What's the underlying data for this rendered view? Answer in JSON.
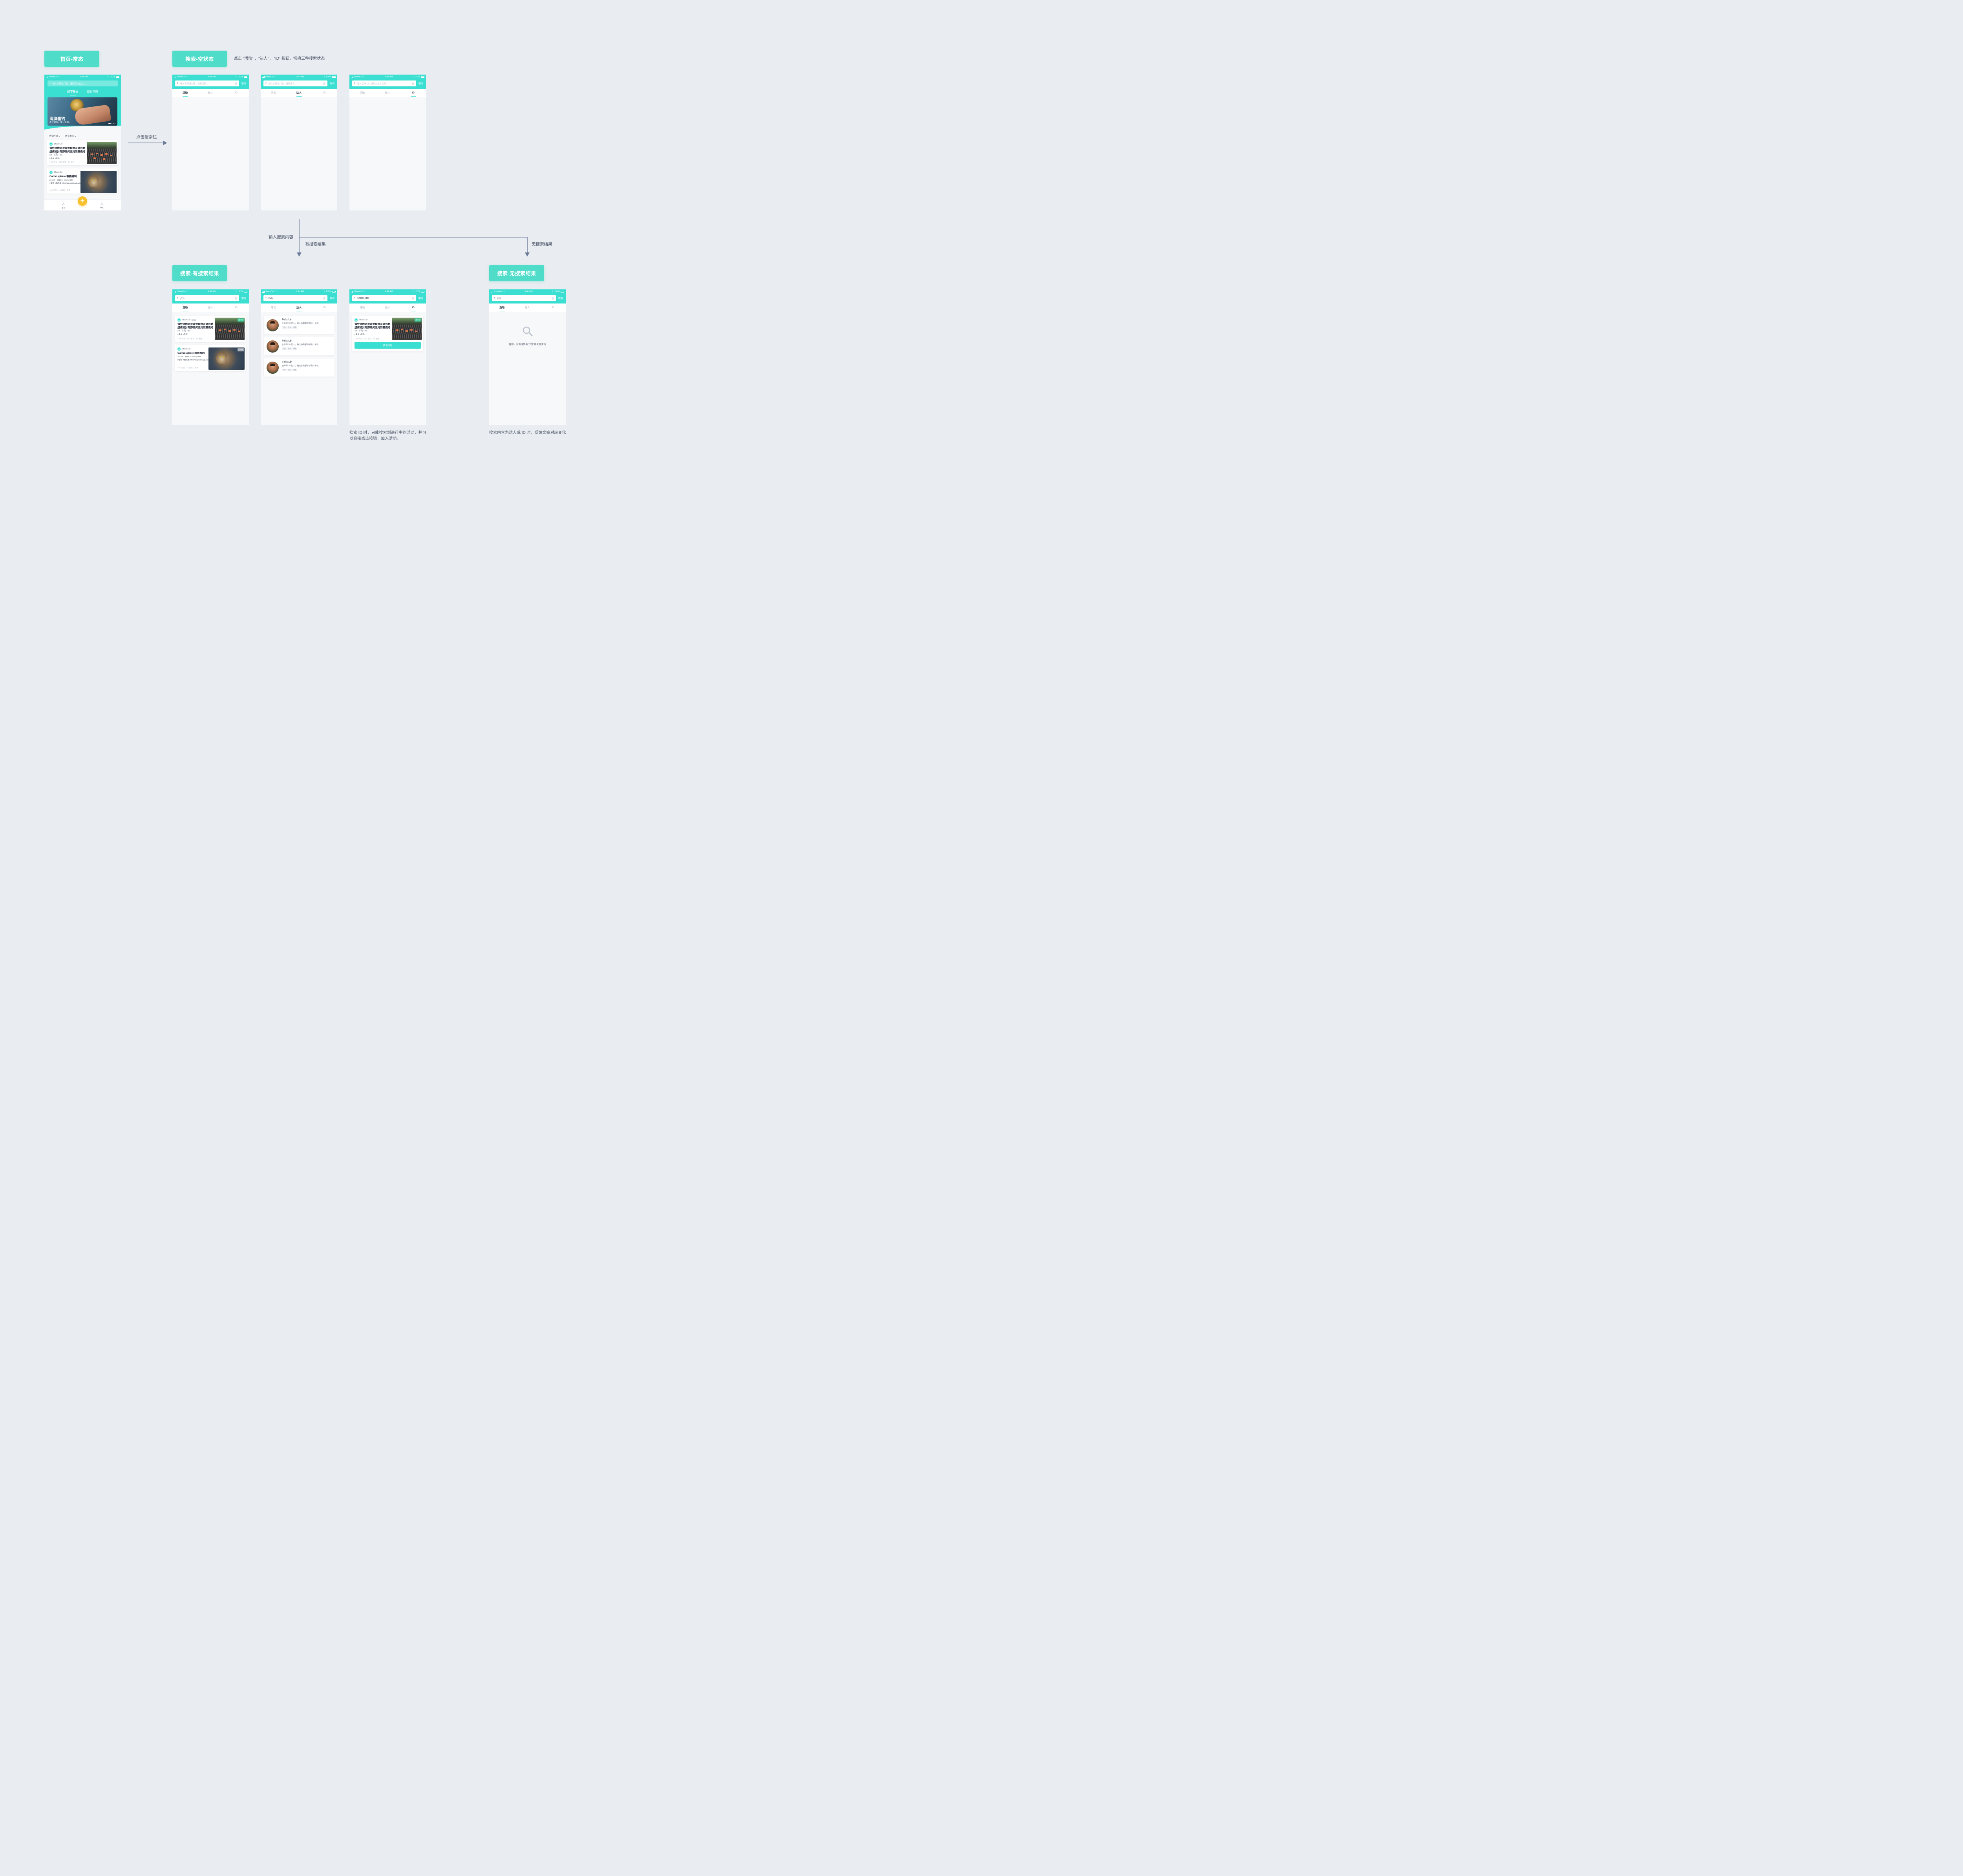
{
  "labels": {
    "home": "首页-常态",
    "search_empty": "搜索-空状态",
    "search_results": "搜索-有搜索结果",
    "search_no_results": "搜索-无搜索结果"
  },
  "notes": {
    "tap_switch": "点击 “活动” 、“达人” 、“ID” 按钮，切换三种搜索状态",
    "id_note": "搜索 ID 时，只能搜索到进行中的活动，并可以直接点击按钮，加入活动。",
    "no_result_note": "搜索内容为达人或 ID 时，反馈文案对应变化"
  },
  "flow": {
    "tap_search": "点击搜索栏",
    "input_search": "输入搜索内容",
    "has_results": "有搜索结果",
    "no_results": "无搜索结果"
  },
  "status": {
    "carrier": "ShareGo",
    "time": "9:41 AM",
    "battery": "100%"
  },
  "search": {
    "cancel": "取消",
    "tabs": [
      "活动",
      "达人",
      "ID"
    ],
    "ph_activity": "输入名称或兴趣，搜索活动...",
    "ph_person": "输入名称或兴趣，搜索达人...",
    "ph_id": "输入活动 ID，搜索并加入活动...",
    "q_activity": "户外",
    "q_person": "Felix",
    "q_id": "1298156451"
  },
  "home": {
    "search_ph": "输入名称或兴趣，搜索活动或达人...",
    "tabs": [
      "时下热点",
      "精彩回顾"
    ],
    "hero_title": "海滨垂钓",
    "hero_sub": "老少咸宜，夏日之选。",
    "filters": [
      "所有时间",
      "所有地点"
    ],
    "nav": [
      "首页",
      "个人"
    ]
  },
  "cards": {
    "bbq": {
      "brand": "ShareGo",
      "title": "郊野烧烤派对郊野烧烤派对郊野烧烤派对郊野烧烤派对郊野烧烤派对郊...",
      "meta": "3.8 · Surry Hills",
      "cat": "#美食 #户外",
      "stats": "1.4k 浏览 · 233 喜欢 · 66 报名",
      "badge": "进行中"
    },
    "cat": {
      "brand": "ShareGo",
      "title": "Catmosphere 吸猫福利",
      "meta": "2018.6 - 2019.6 · Surry Hills",
      "cat": "#宠物 #撸元素 #hashtaghashtaghashtag",
      "stats": "24k 浏览 · 24 喜欢 · 免费",
      "badge": "已结束",
      "tag": "官方"
    }
  },
  "person": {
    "name": "Felix Lin",
    "desc": "全世界 70 亿人，绝大多数都不够我一半劲。",
    "chips": [
      "户外",
      "社交",
      "摄影"
    ]
  },
  "join": "参与活动",
  "empty": "抱歉，没有找到与“户外”相关的活动",
  "colors": {
    "accent": "#3bdfd2",
    "label": "#4fdcc9",
    "fab": "#f7c12f",
    "arrow": "#6b7a99"
  }
}
